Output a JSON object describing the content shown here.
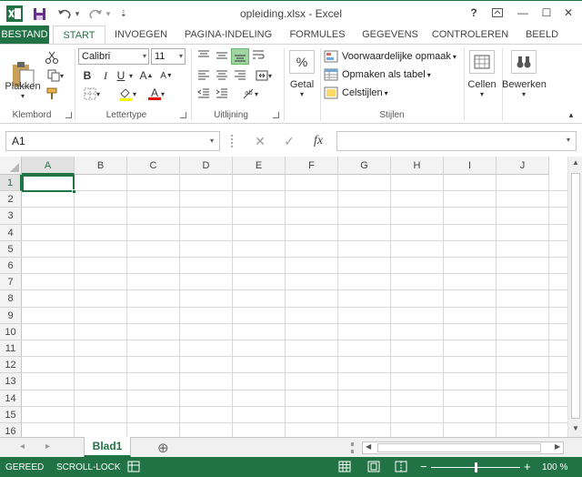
{
  "window": {
    "title": "opleiding.xlsx - Excel",
    "help": "?",
    "restore_icon": "ribbon-display-icon",
    "minimize": "—",
    "maximize": "☐",
    "close": "✕"
  },
  "quick_access": {
    "undo_arrow": "▾",
    "redo_arrow": "▾",
    "customize": "⇣"
  },
  "tabs": [
    "BESTAND",
    "START",
    "INVOEGEN",
    "PAGINA-INDELING",
    "FORMULES",
    "GEGEVENS",
    "CONTROLEREN",
    "BEELD"
  ],
  "ribbon": {
    "clipboard": {
      "paste_label": "Plakken",
      "group_label": "Klembord"
    },
    "font": {
      "font_name": "Calibri",
      "font_size": "11",
      "bold": "B",
      "italic": "I",
      "underline": "U",
      "grow": "A",
      "shrink": "A",
      "font_color_letter": "A",
      "group_label": "Lettertype"
    },
    "alignment": {
      "group_label": "Uitlijning"
    },
    "number": {
      "percent": "%",
      "label": "Getal"
    },
    "styles": {
      "conditional": "Voorwaardelijke opmaak",
      "table": "Opmaken als tabel",
      "cell_styles": "Celstijlen",
      "group_label": "Stijlen"
    },
    "cells": {
      "label": "Cellen"
    },
    "editing": {
      "label": "Bewerken"
    },
    "dropdown_arrow": "▾"
  },
  "formula_bar": {
    "name_box": "A1",
    "cancel": "✕",
    "enter": "✓",
    "fx": "fx",
    "value": ""
  },
  "grid": {
    "columns": [
      "A",
      "B",
      "C",
      "D",
      "E",
      "F",
      "G",
      "H",
      "I",
      "J"
    ],
    "rows": [
      "1",
      "2",
      "3",
      "4",
      "5",
      "6",
      "7",
      "8",
      "9",
      "10",
      "11",
      "12",
      "13",
      "14",
      "15",
      "16"
    ],
    "selected_cell": "A1"
  },
  "sheets": {
    "active": "Blad1",
    "add": "⊕",
    "prev": "◂",
    "next": "▸"
  },
  "status": {
    "ready": "GEREED",
    "scroll_lock": "SCROLL-LOCK",
    "zoom": "100 %",
    "zoom_minus": "−",
    "zoom_plus": "+",
    "zoom_level": 0.5
  },
  "colors": {
    "accent": "#217346"
  }
}
